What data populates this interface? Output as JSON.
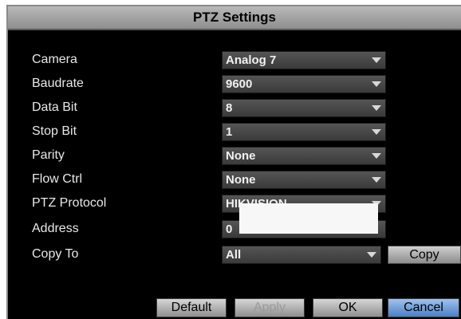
{
  "window": {
    "title": "PTZ Settings"
  },
  "form": {
    "camera": {
      "label": "Camera",
      "value": "Analog 7"
    },
    "baudrate": {
      "label": "Baudrate",
      "value": "9600"
    },
    "databit": {
      "label": "Data Bit",
      "value": "8"
    },
    "stopbit": {
      "label": "Stop Bit",
      "value": "1"
    },
    "parity": {
      "label": "Parity",
      "value": "None"
    },
    "flowctrl": {
      "label": "Flow Ctrl",
      "value": "None"
    },
    "protocol": {
      "label": "PTZ Protocol",
      "value": "HIKVISION"
    },
    "address": {
      "label": "Address",
      "value": "0"
    },
    "copyto": {
      "label": "Copy To",
      "value": "All",
      "button": "Copy"
    }
  },
  "footer": {
    "default": "Default",
    "apply": "Apply",
    "ok": "OK",
    "cancel": "Cancel"
  },
  "colors": {
    "background": "#000000",
    "titlebar": "#a8a8a8",
    "field": "#4a4a4a",
    "accent": "#6a9be0"
  },
  "icons": {
    "dropdown": "chevron-down-icon"
  }
}
